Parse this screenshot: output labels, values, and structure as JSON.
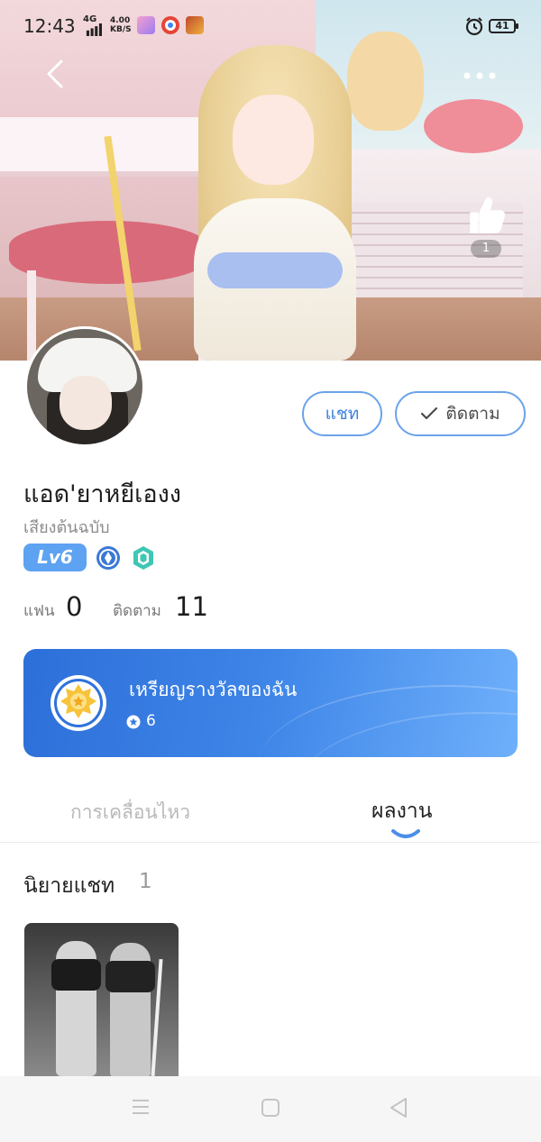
{
  "status_bar": {
    "time": "12:43",
    "network": "4G",
    "speed_value": "4.00",
    "speed_unit": "KB/S",
    "battery": "41"
  },
  "header": {
    "like_count": "1"
  },
  "profile": {
    "name": "แอด'ยาหยีเองง",
    "subtitle": "เสียงต้นฉบับ",
    "level": "Lv6",
    "fans_label": "แฟน",
    "fans_count": "0",
    "following_label": "ติดตาม",
    "following_count": "11",
    "chat_button": "แชท",
    "follow_button": "ติดตาม"
  },
  "medal_card": {
    "title": "เหรียญรางวัลของฉัน",
    "count": "6"
  },
  "tabs": [
    {
      "label": "การเคลื่อนไหว",
      "active": false
    },
    {
      "label": "ผลงาน",
      "active": true
    }
  ],
  "section": {
    "title": "นิยายแชท",
    "count": "1"
  },
  "colors": {
    "accent": "#3d82dd",
    "level_badge": "#5ea2f2",
    "medal_card_start": "#2d6fd9",
    "medal_card_end": "#6fb0fb"
  },
  "icons": {
    "back": "chevron-left-icon",
    "more": "more-dots-icon",
    "like": "thumbs-up-icon",
    "check": "check-icon",
    "medal": "medal-icon",
    "star": "star-icon"
  }
}
